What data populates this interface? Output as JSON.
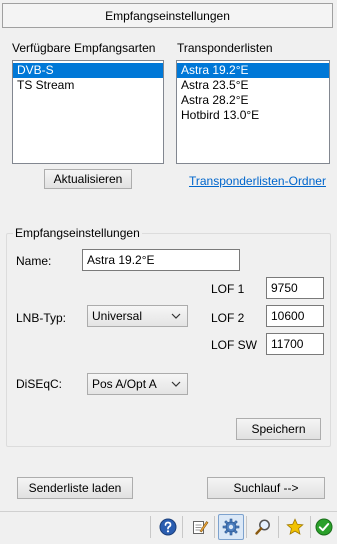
{
  "header": {
    "title": "Empfangseinstellungen"
  },
  "receive_types": {
    "label": "Verfügbare Empfangsarten",
    "items": [
      "DVB-S",
      "TS Stream"
    ],
    "selected_index": 0
  },
  "transponder_lists": {
    "label": "Transponderlisten",
    "items": [
      "Astra 19.2°E",
      "Astra 23.5°E",
      "Astra 28.2°E",
      "Hotbird 13.0°E"
    ],
    "selected_index": 0
  },
  "refresh_button": {
    "label": "Aktualisieren"
  },
  "folder_link": {
    "label": "Transponderlisten-Ordner"
  },
  "settings": {
    "group_title": "Empfangseinstellungen",
    "name_label": "Name:",
    "name_value": "Astra 19.2°E",
    "lnb_label": "LNB-Typ:",
    "lnb_value": "Universal",
    "lof1_label": "LOF 1",
    "lof1_value": "9750",
    "lof2_label": "LOF 2",
    "lof2_value": "10600",
    "lofsw_label": "LOF SW",
    "lofsw_value": "11700",
    "diseqc_label": "DiSEqC:",
    "diseqc_value": "Pos A/Opt A",
    "save_label": "Speichern"
  },
  "footer": {
    "load_list_label": "Senderliste laden",
    "scan_label": "Suchlauf -->"
  },
  "statusbar": {
    "icons": [
      "help-icon",
      "edit-icon",
      "settings-icon",
      "search-icon",
      "favorites-icon",
      "ok-icon"
    ],
    "active_icon": "settings-icon"
  },
  "colors": {
    "selection": "#0078d7",
    "link": "#0066cc",
    "help_blue": "#2a5db0",
    "ok_green": "#2aa02a",
    "star_yellow": "#f2c200"
  }
}
